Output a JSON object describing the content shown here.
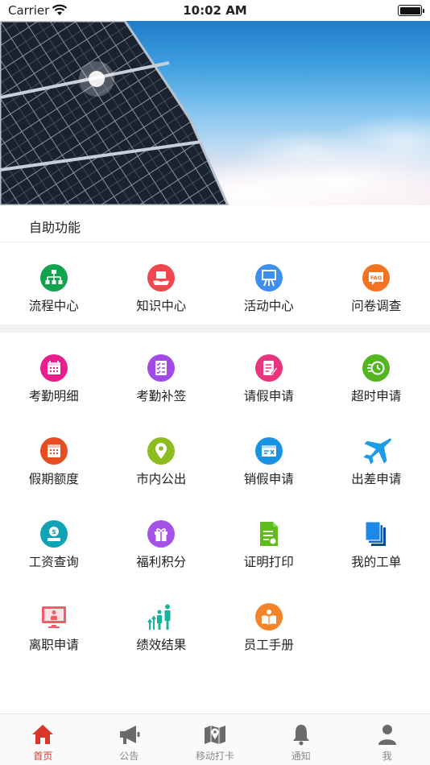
{
  "status_bar": {
    "carrier": "Carrier",
    "time": "10:02 AM"
  },
  "section": {
    "title": "自助功能"
  },
  "primary_items": [
    {
      "label": "流程中心",
      "icon": "flowchart-icon",
      "color": "#12a34f"
    },
    {
      "label": "知识中心",
      "icon": "knowledge-hand-icon",
      "color": "#f0474f"
    },
    {
      "label": "活动中心",
      "icon": "activity-easel-icon",
      "color": "#3d8ff0"
    },
    {
      "label": "问卷调查",
      "icon": "faq-bubble-icon",
      "color": "#f37323"
    }
  ],
  "service_items": [
    {
      "label": "考勤明细",
      "icon": "calendar-icon",
      "color": "#e91e8c"
    },
    {
      "label": "考勤补签",
      "icon": "checklist-icon",
      "color": "#a24ae8"
    },
    {
      "label": "请假申请",
      "icon": "leave-form-icon",
      "color": "#e8357d"
    },
    {
      "label": "超时申请",
      "icon": "overtime-clock-icon",
      "color": "#53b51f"
    },
    {
      "label": "假期额度",
      "icon": "holiday-calendar-icon",
      "color": "#e64d22"
    },
    {
      "label": "市内公出",
      "icon": "location-pin-icon",
      "color": "#8cbc1d"
    },
    {
      "label": "销假申请",
      "icon": "cancel-leave-icon",
      "color": "#1992e6"
    },
    {
      "label": "出差申请",
      "icon": "airplane-icon",
      "color": "#1a9ce6"
    },
    {
      "label": "工资查询",
      "icon": "salary-coin-icon",
      "color": "#10a3b5"
    },
    {
      "label": "福利积分",
      "icon": "gift-icon",
      "color": "#a552e6"
    },
    {
      "label": "证明打印",
      "icon": "certificate-icon",
      "color": "#5fbc1d"
    },
    {
      "label": "我的工单",
      "icon": "documents-icon",
      "color": "#1565c0"
    },
    {
      "label": "离职申请",
      "icon": "resign-monitor-icon",
      "color": "#f25c6b"
    },
    {
      "label": "绩效结果",
      "icon": "performance-people-icon",
      "color": "#17b39b"
    },
    {
      "label": "员工手册",
      "icon": "handbook-icon",
      "color": "#f5832a"
    }
  ],
  "tabs": [
    {
      "label": "首页",
      "icon": "home-icon",
      "active": true
    },
    {
      "label": "公告",
      "icon": "megaphone-icon",
      "active": false
    },
    {
      "label": "移动打卡",
      "icon": "map-pin-icon",
      "active": false
    },
    {
      "label": "通知",
      "icon": "bell-icon",
      "active": false
    },
    {
      "label": "我",
      "icon": "person-icon",
      "active": false
    }
  ],
  "colors": {
    "accent": "#d9362c",
    "tab_inactive": "#888888",
    "tab_icon": "#6b6b6b",
    "divider": "#f1f1f1"
  }
}
